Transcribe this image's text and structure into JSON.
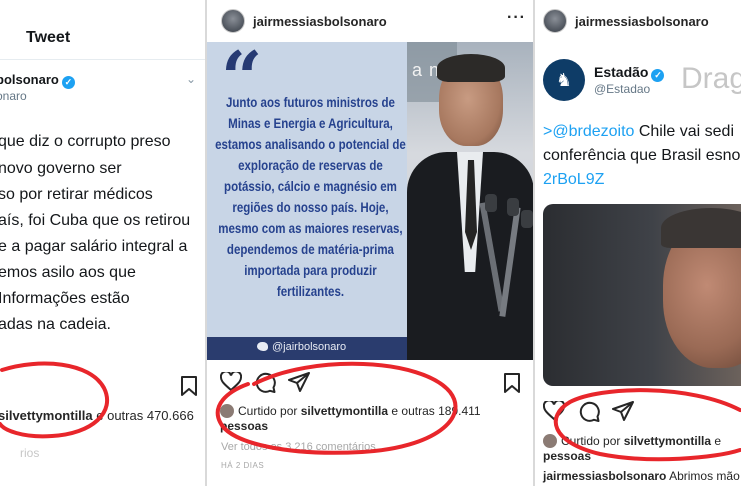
{
  "left": {
    "header_title": "Tweet",
    "handle": "bolsonaro",
    "subhandle": "onaro",
    "tweet_lines": [
      "que diz o corrupto preso",
      "novo governo ser",
      "so por retirar médicos",
      "aís, foi Cuba que os retirou",
      "e a pagar salário integral a",
      "emos asilo aos que",
      "Informações estão",
      "adas na cadeia."
    ],
    "liked_user": "silvettymontilla",
    "liked_rest": " e outras 470.666",
    "faded": "rios"
  },
  "middle": {
    "username": "jairmessiasbolsonaro",
    "quote_text": "Junto aos futuros ministros de Minas e Energia e Agricultura, estamos analisando o potencial de exploração de reservas de potássio, cálcio e magnésio em regiões do nosso país. Hoje, mesmo com as maiores reservas, dependemos de matéria-prima importada para produzir fertilizantes.",
    "quote_credit": "@jairbolsonaro",
    "liked_prefix": "Curtido por ",
    "liked_user": "silvettymontilla",
    "liked_rest": " e outras 189.411",
    "liked_line2": "pessoas",
    "comments": "Ver todos os 3.216 comentários",
    "date": "HÁ 2 DIAS",
    "bg_text": "a nos"
  },
  "right": {
    "username": "jairmessiasbolsonaro",
    "outlet_name": "Estadão",
    "outlet_handle": "@Estadao",
    "watermark": "Drag",
    "tweet_mention": ">@brdezoito",
    "tweet_line1_rest": " Chile vai sedi",
    "tweet_line2": "conferência que Brasil esno",
    "tweet_link": "2rBoL9Z",
    "liked_prefix": "Curtido por ",
    "liked_user": "silvettymontilla",
    "liked_rest": " e",
    "liked_line2": "pessoas",
    "caption_user": "jairmessiasbolsonaro",
    "caption_text": " Abrimos mão"
  },
  "colors": {
    "marker_red": "#e8262b",
    "twitter_blue": "#1da1f2",
    "quote_blue": "#26428e"
  }
}
